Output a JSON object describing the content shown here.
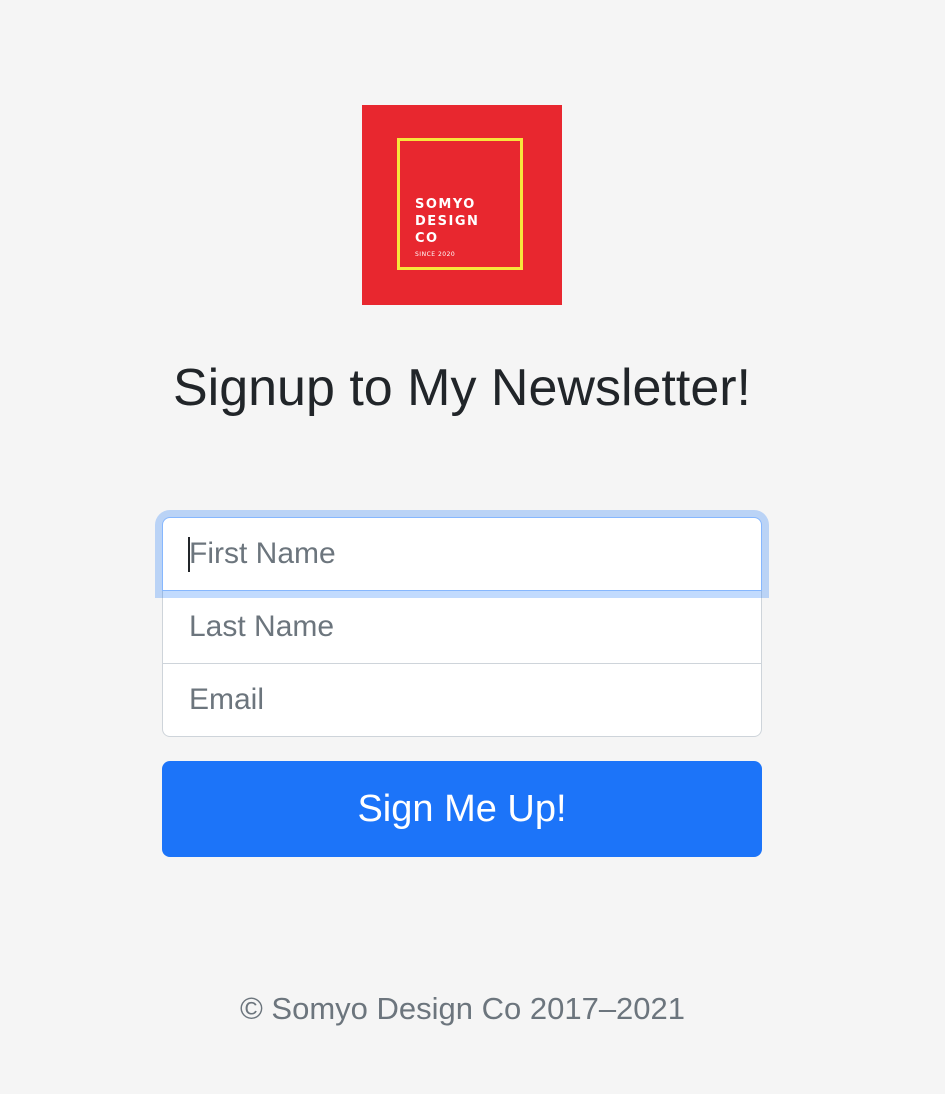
{
  "logo": {
    "lines": [
      "SOMYO",
      "DESIGN",
      "CO"
    ],
    "since": "SINCE 2020",
    "colors": {
      "background": "#e8272f",
      "frame": "#f7e43c"
    }
  },
  "heading": "Signup to My Newsletter!",
  "form": {
    "first_name_placeholder": "First Name",
    "last_name_placeholder": "Last Name",
    "email_placeholder": "Email",
    "submit_label": "Sign Me Up!"
  },
  "footer": "© Somyo Design Co 2017–2021",
  "colors": {
    "accent": "#1c74f9",
    "page_background": "#f5f5f5"
  }
}
